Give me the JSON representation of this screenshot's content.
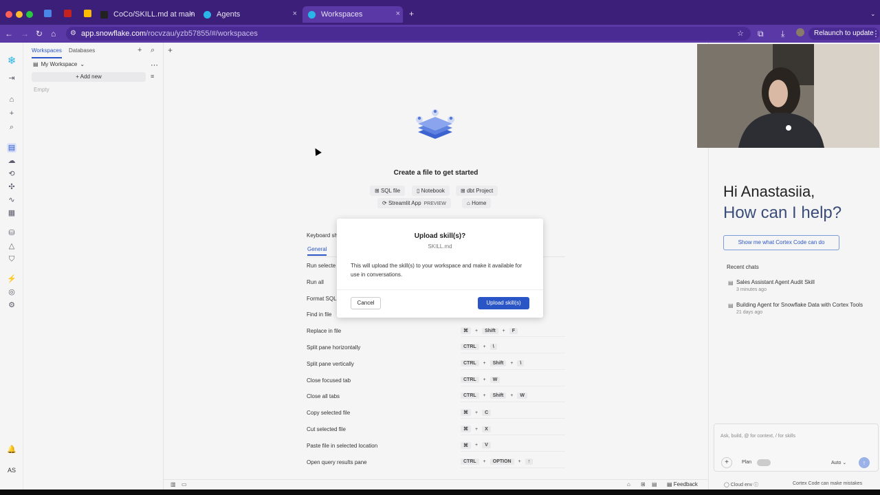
{
  "browser": {
    "tabs": [
      {
        "title": "CoCo/SKILL.md at main · Res",
        "active": false
      },
      {
        "title": "Agents",
        "active": false
      },
      {
        "title": "Workspaces",
        "active": true
      }
    ],
    "url_host": "app.snowflake.com",
    "url_path": "/rocvzau/yzb57855/#/workspaces",
    "relaunch_label": "Relaunch to update"
  },
  "explorer": {
    "tabs": [
      "Workspaces",
      "Databases"
    ],
    "workspace_name": "My Workspace",
    "add_new": "Add new",
    "empty": "Empty"
  },
  "main": {
    "hero_title": "Create a file to get started",
    "chips": {
      "sql": "SQL file",
      "notebook": "Notebook",
      "dbt": "dbt Project",
      "streamlit": "Streamlit App",
      "preview": "PREVIEW",
      "home": "Home"
    },
    "kb_title": "Keyboard sh",
    "kb_tab": "General",
    "shortcuts": [
      {
        "label": "Run selecte",
        "keys": []
      },
      {
        "label": "Run all",
        "keys": []
      },
      {
        "label": "Format SQL",
        "keys": []
      },
      {
        "label": "Find in file",
        "keys": []
      },
      {
        "label": "Replace in file",
        "keys": [
          "⌘",
          "+",
          "Shift",
          "+",
          "F"
        ]
      },
      {
        "label": "Split pane horizontally",
        "keys": [
          "CTRL",
          "+",
          "\\"
        ]
      },
      {
        "label": "Split pane vertically",
        "keys": [
          "CTRL",
          "+",
          "Shift",
          "+",
          "\\"
        ]
      },
      {
        "label": "Close focused tab",
        "keys": [
          "CTRL",
          "+",
          "W"
        ]
      },
      {
        "label": "Close all tabs",
        "keys": [
          "CTRL",
          "+",
          "Shift",
          "+",
          "W"
        ]
      },
      {
        "label": "Copy selected file",
        "keys": [
          "⌘",
          "+",
          "C"
        ]
      },
      {
        "label": "Cut selected file",
        "keys": [
          "⌘",
          "+",
          "X"
        ]
      },
      {
        "label": "Paste file in selected location",
        "keys": [
          "⌘",
          "+",
          "V"
        ]
      },
      {
        "label": "Open query results pane",
        "keys": [
          "CTRL",
          "+",
          "OPTION",
          "+",
          "↑"
        ]
      }
    ]
  },
  "modal": {
    "title": "Upload skill(s)?",
    "subtitle": "SKILL.md",
    "body": "This will upload the skill(s) to your workspace and make it available for use in conversations.",
    "cancel": "Cancel",
    "confirm": "Upload skill(s)"
  },
  "cortex": {
    "greeting_line1": "Hi Anastasiia,",
    "greeting_line2": "How can I help?",
    "show_me": "Show me what Cortex Code can do",
    "recent_heading": "Recent chats",
    "recent": [
      {
        "title": "Sales Assistant Agent Audit Skill",
        "ago": "3 minutes ago"
      },
      {
        "title": "Building Agent for Snowflake Data with Cortex Tools",
        "ago": "21 days ago"
      }
    ],
    "placeholder": "Ask, build, @ for context, / for skills",
    "plan": "Plan",
    "auto": "Auto",
    "cloud_env": "Cloud env",
    "mistakes": "Cortex Code can make mistakes"
  },
  "status": {
    "feedback": "Feedback"
  },
  "user_initials": "AS",
  "colors": {
    "accent": "#2a55c7",
    "browser_chrome": "#5a38a6"
  }
}
